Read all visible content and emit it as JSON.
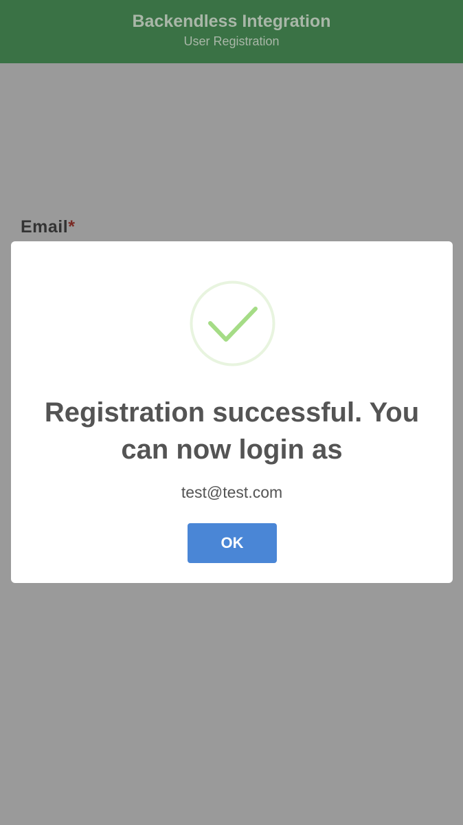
{
  "header": {
    "title": "Backendless Integration",
    "subtitle": "User Registration"
  },
  "form": {
    "email_label": "Email",
    "required_marker": "*"
  },
  "dialog": {
    "icon": "success-checkmark-icon",
    "title": "Registration successful. You can now login as",
    "text": "test@test.com",
    "ok_label": "OK"
  },
  "colors": {
    "header_bg": "#3a7245",
    "overlay": "#9a9a9a",
    "success_green": "#a5dc86",
    "button_blue": "#4a86d6"
  }
}
